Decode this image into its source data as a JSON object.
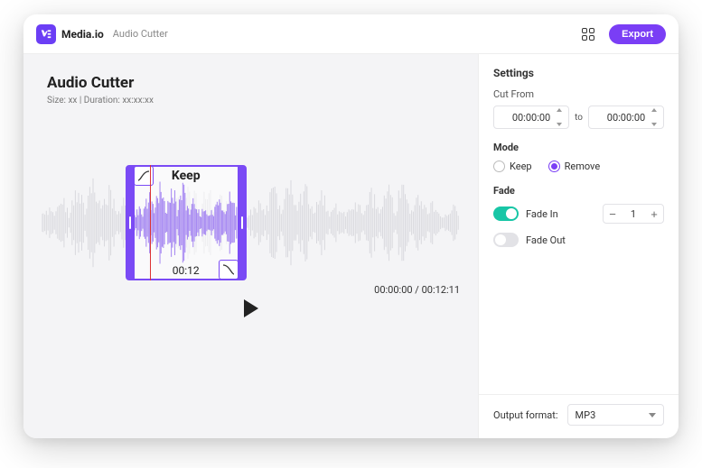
{
  "header": {
    "brand": "Media.io",
    "breadcrumb": "Audio Cutter",
    "export_label": "Export"
  },
  "main": {
    "title": "Audio Cutter",
    "meta": "Size: xx | Duration: xx:xx:xx",
    "selection_label": "Keep",
    "selection_time": "00:12",
    "current_time": "00:00:00",
    "total_time": "00:12:11",
    "selection_start_pct": 20,
    "selection_end_pct": 49,
    "playhead_pct": 26
  },
  "settings": {
    "heading": "Settings",
    "cut_from_label": "Cut From",
    "from_value": "00:00:00",
    "to_label": "to",
    "to_value": "00:00:00",
    "mode_label": "Mode",
    "mode_options": {
      "keep": "Keep",
      "remove": "Remove"
    },
    "mode_selected": "remove",
    "fade_label": "Fade",
    "fade_in_label": "Fade In",
    "fade_in_on": true,
    "fade_in_amount": "1",
    "fade_out_label": "Fade Out",
    "fade_out_on": false,
    "output_label": "Output format:",
    "output_value": "MP3"
  }
}
